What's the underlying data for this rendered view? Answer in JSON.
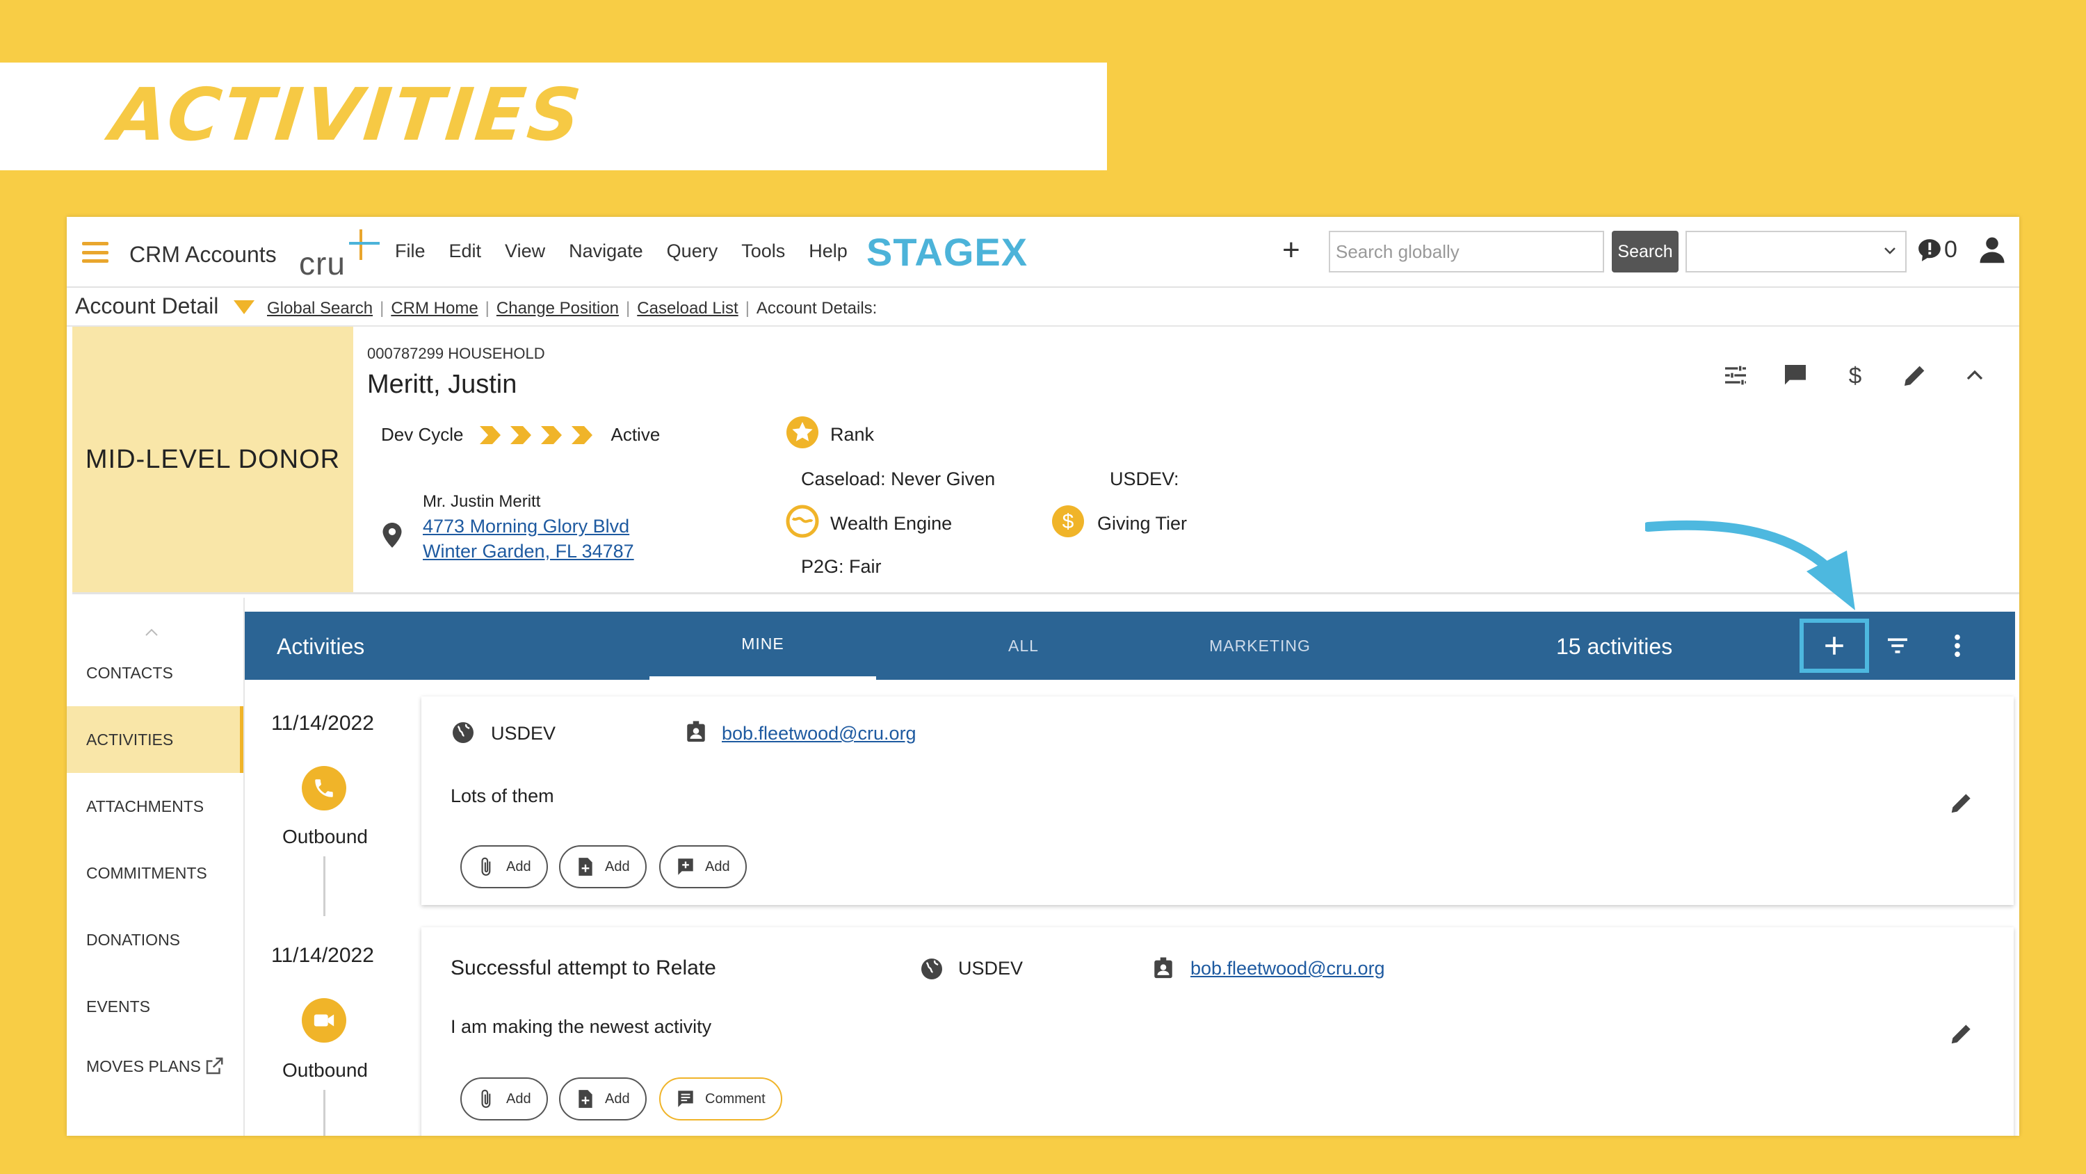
{
  "banner": {
    "title": "Activities"
  },
  "topbar": {
    "app_name": "CRM Accounts",
    "logo_text": "cru",
    "menu": [
      "File",
      "Edit",
      "View",
      "Navigate",
      "Query",
      "Tools",
      "Help"
    ],
    "environment": "STAGEX",
    "search_placeholder": "Search globally",
    "search_button": "Search",
    "notification_count": "0"
  },
  "breadcrumb": {
    "section": "Account Detail",
    "links": [
      "Global Search",
      "CRM Home",
      "Change Position",
      "Caseload List"
    ],
    "current": "Account Details:"
  },
  "account": {
    "donor_level": "MID-LEVEL DONOR",
    "household_id": "000787299 HOUSEHOLD",
    "name": "Meritt, Justin",
    "dev_cycle_label": "Dev Cycle",
    "dev_cycle_status": "Active",
    "mailing_name": "Mr. Justin Meritt",
    "address_line1": "4773 Morning Glory Blvd",
    "address_line2": "Winter Garden, FL 34787",
    "rank_label": "Rank",
    "caseload": "Caseload:  Never Given",
    "usdev_label": "USDEV:",
    "wealth_label": "Wealth Engine",
    "giving_label": "Giving Tier",
    "p2g": "P2G:  Fair"
  },
  "sidebar": {
    "items": [
      "CONTACTS",
      "ACTIVITIES",
      "ATTACHMENTS",
      "COMMITMENTS",
      "DONATIONS",
      "EVENTS",
      "MOVES PLANS"
    ],
    "active": "ACTIVITIES"
  },
  "activities": {
    "title": "Activities",
    "tabs": [
      "MINE",
      "ALL",
      "MARKETING"
    ],
    "active_tab": "MINE",
    "count": "15 activities",
    "items": [
      {
        "date": "11/14/2022",
        "type_icon": "phone-icon",
        "direction": "Outbound",
        "org": "USDEV",
        "email": "bob.fleetwood@cru.org",
        "title": "",
        "note": "Lots of them",
        "actions": [
          "Add",
          "Add",
          "Add"
        ]
      },
      {
        "date": "11/14/2022",
        "type_icon": "video-icon",
        "direction": "Outbound",
        "org": "USDEV",
        "email": "bob.fleetwood@cru.org",
        "title": "Successful attempt to Relate",
        "note": "I am making the newest activity",
        "actions": [
          "Add",
          "Add",
          "Comment"
        ]
      }
    ]
  },
  "colors": {
    "background": "#F8CD45",
    "activities_bar": "#2B6494",
    "accent_yellow": "#F0B429",
    "highlight_blue": "#4DB8DF",
    "donor_box": "#F9E6A8"
  }
}
